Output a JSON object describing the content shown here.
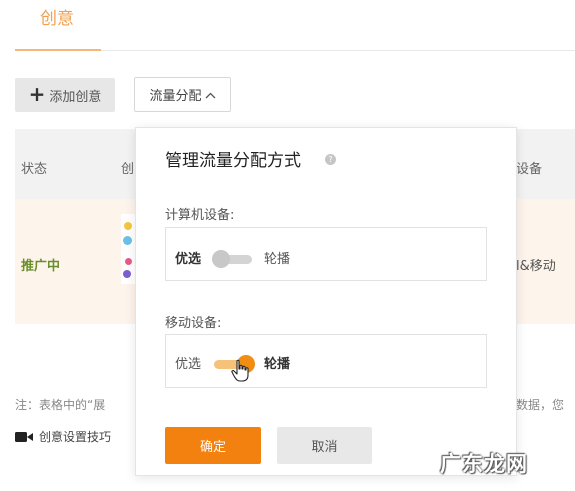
{
  "tab": {
    "title": "创意"
  },
  "toolbar": {
    "add_label": "添加创意",
    "flow_label": "流量分配"
  },
  "table": {
    "headers": {
      "status": "状态",
      "creative": "创",
      "device": "设备"
    },
    "row": {
      "status": "推广中",
      "device": "l&移动"
    }
  },
  "note": {
    "left": "注：表格中的“展",
    "right": "数据，您"
  },
  "tips": {
    "label": "创意设置技巧"
  },
  "popover": {
    "title": "管理流量分配方式",
    "computer": {
      "label": "计算机设备:",
      "option_left": "优选",
      "option_right": "轮播",
      "selected": "优选"
    },
    "mobile": {
      "label": "移动设备:",
      "option_left": "优选",
      "option_right": "轮播",
      "selected": "轮播"
    },
    "confirm_label": "确定",
    "cancel_label": "取消"
  },
  "watermark": "广东龙网",
  "colors": {
    "accent": "#f3810f",
    "tab_title": "#f0a050",
    "status_green": "#6a8f2a",
    "row_highlight": "#fdf4ec"
  }
}
